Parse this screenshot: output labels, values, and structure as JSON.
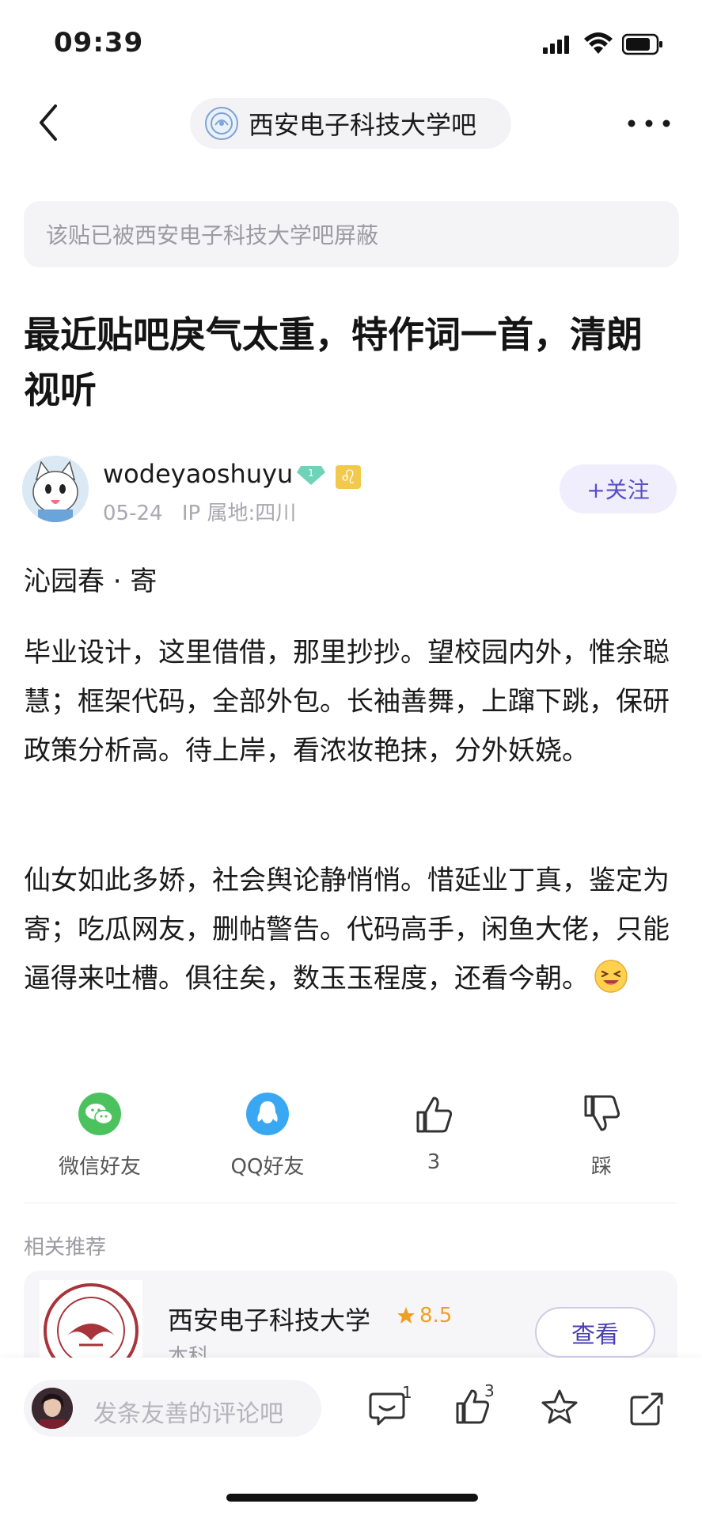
{
  "status_bar": {
    "time": "09:39"
  },
  "nav": {
    "forum_name": "西安电子科技大学吧"
  },
  "notice": "该贴已被西安电子科技大学吧屏蔽",
  "post": {
    "title": "最近贴吧戾气太重，特作词一首，清朗视听",
    "author": {
      "username": "wodeyaoshuyu",
      "level": "1",
      "zodiac_badge": "♌",
      "date": "05-24",
      "ip_location": "IP 属地:四川"
    },
    "follow_label": "+关注",
    "poem_title": "沁园春 · 寄",
    "paragraphs": [
      "毕业设计，这里借借，那里抄抄。望校园内外，惟余聪慧；框架代码，全部外包。长袖善舞，上蹿下跳，保研政策分析高。待上岸，看浓妆艳抹，分外妖娆。",
      "仙女如此多娇，社会舆论静悄悄。惜延业丁真，鉴定为寄；吃瓜网友，删帖警告。代码高手，闲鱼大佬，只能逼得来吐槽。俱往矣，数玉玉程度，还看今朝。"
    ]
  },
  "actions": {
    "wechat": "微信好友",
    "qq": "QQ好友",
    "like_count": "3",
    "dislike": "踩"
  },
  "related": {
    "label": "相关推荐",
    "card": {
      "name": "西安电子科技大学",
      "score": "8.5",
      "subtitle": "本科",
      "button": "查看"
    }
  },
  "bottom_bar": {
    "comment_placeholder": "发条友善的评论吧",
    "comment_count": "1",
    "like_count": "3"
  },
  "colors": {
    "accent": "#5a4ec9",
    "star": "#f0a020",
    "wechat": "#4cc25f",
    "qq": "#3aa7f2"
  }
}
